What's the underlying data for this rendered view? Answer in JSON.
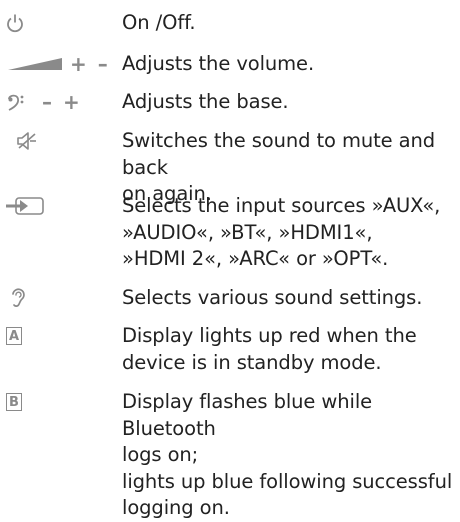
{
  "rows": [
    {
      "icon": "power-icon",
      "text": "On /Off."
    },
    {
      "icon": "volume-ramp-icon",
      "symbol_text": "+ –",
      "text": "Adjusts the volume."
    },
    {
      "icon": "bass-clef-icon",
      "symbol_text": "– +",
      "text": "Adjusts the base."
    },
    {
      "icon": "mute-speaker-icon",
      "text": "Switches the sound to mute and back\non again."
    },
    {
      "icon": "input-source-icon",
      "text": "Selects the input sources »AUX«,\n»AUDIO«, »BT«, »HDMI1«,\n»HDMI 2«, »ARC« or »OPT«."
    },
    {
      "icon": "ear-icon",
      "text": "Selects various sound settings."
    },
    {
      "icon": "label-a-icon",
      "symbol_text": "A",
      "text": "Display lights up red when the\ndevice is in standby mode."
    },
    {
      "icon": "label-b-icon",
      "symbol_text": "B",
      "text": "Display flashes blue while Bluetooth\nlogs on;\nlights up blue following successful\nlogging on."
    }
  ],
  "colors": {
    "symbol": "#8a8a8a",
    "text": "#222222"
  }
}
